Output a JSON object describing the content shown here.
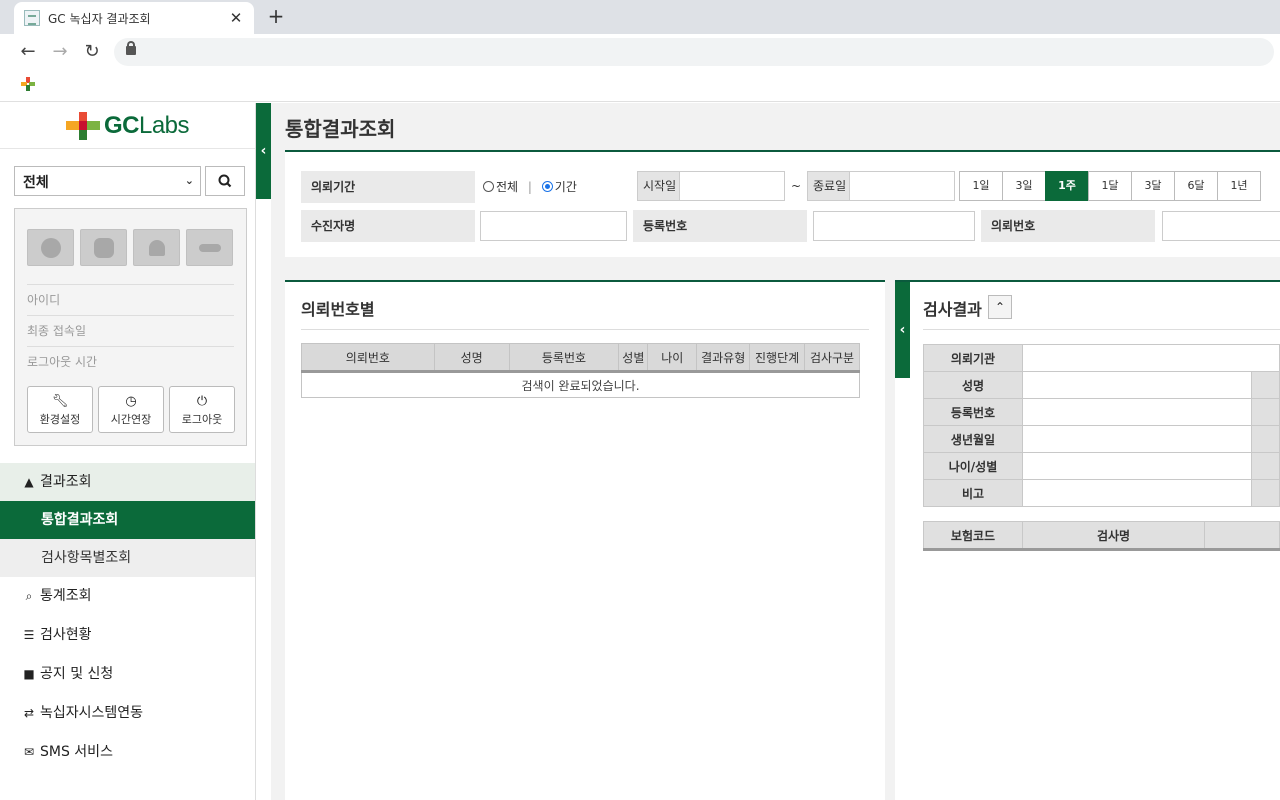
{
  "browser": {
    "tab_title": "GC 녹십자 결과조회",
    "tab_close": "✕",
    "new_tab": "+",
    "back": "←",
    "forward": "→",
    "reload": "↻"
  },
  "sidebar": {
    "logo_gc": "GC",
    "logo_labs": "Labs",
    "scope_select": "전체",
    "user_info": [
      "아이디",
      "최종 접속일",
      "로그아웃 시간"
    ],
    "buttons": [
      {
        "icon": "wrench-icon",
        "label": "환경설정"
      },
      {
        "icon": "clock-icon",
        "label": "시간연장"
      },
      {
        "icon": "power-icon",
        "label": "로그아웃"
      }
    ],
    "nav": {
      "group": "결과조회",
      "sub_active": "통합결과조회",
      "sub_2": "검사항목별조회",
      "items": [
        "통계조회",
        "검사현황",
        "공지 및 신청",
        "녹십자시스템연동",
        "SMS 서비스"
      ]
    }
  },
  "main": {
    "page_title": "통합결과조회",
    "filter": {
      "period_label": "의뢰기간",
      "radio_all": "전체",
      "radio_sep": "|",
      "radio_period": "기간",
      "start_tag": "시작일",
      "tilde": "~",
      "end_tag": "종료일",
      "period_buttons": [
        "1일",
        "3일",
        "1주",
        "1달",
        "3달",
        "6달",
        "1년"
      ],
      "active_period": "1주",
      "patient_label": "수진자명",
      "reg_label": "등록번호",
      "req_label": "의뢰번호"
    },
    "left_panel": {
      "title": "의뢰번호별",
      "columns": [
        "의뢰번호",
        "성명",
        "등록번호",
        "성별",
        "나이",
        "결과유형",
        "진행단계",
        "검사구분"
      ],
      "empty_message": "검색이 완료되었습니다."
    },
    "right_panel": {
      "title": "검사결과",
      "toggle": "⌃",
      "info_rows": [
        "의뢰기관",
        "성명",
        "등록번호",
        "생년월일",
        "나이/성별",
        "비고"
      ],
      "code_columns": [
        "보험코드",
        "검사명"
      ]
    }
  },
  "colors": {
    "brand_green": "#0b6a3a",
    "rule_green": "#0b5a3d"
  }
}
